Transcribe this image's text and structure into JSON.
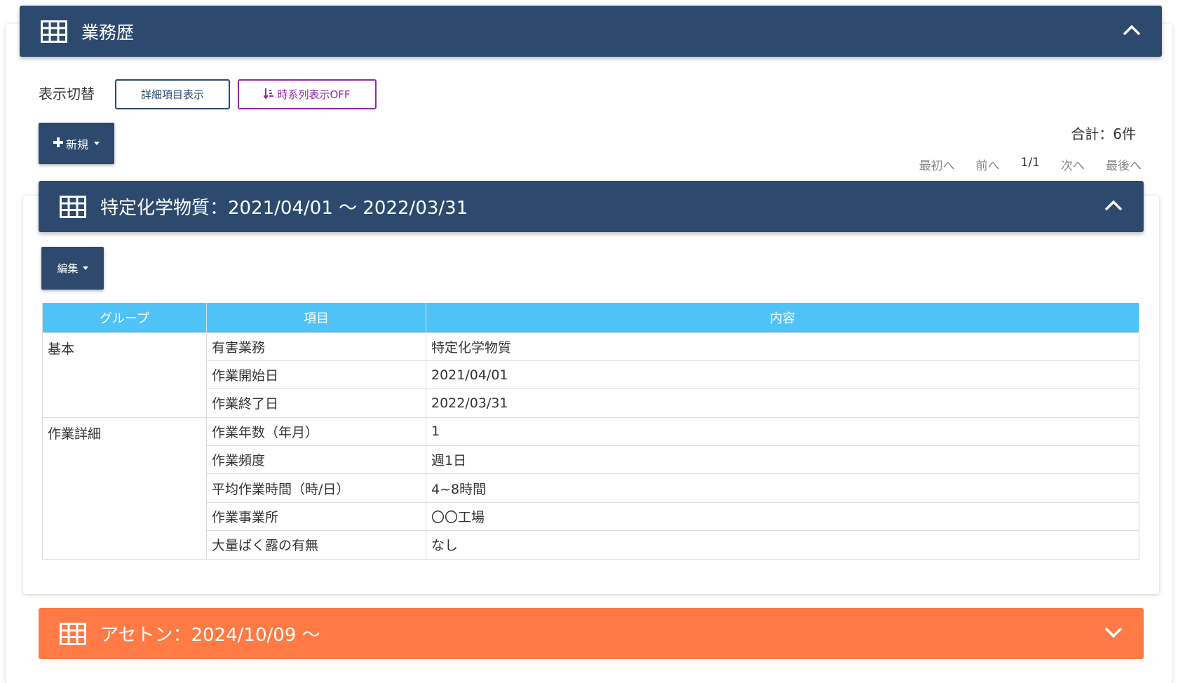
{
  "section": {
    "title": "業務歴"
  },
  "display_toggle": {
    "label": "表示切替",
    "detail_button": "詳細項目表示",
    "timeseries_button": "時系列表示OFF"
  },
  "actions": {
    "new_button": "新規"
  },
  "summary": {
    "total": "合計：6件"
  },
  "pagination": {
    "first": "最初へ",
    "prev": "前へ",
    "current": "1/1",
    "next": "次へ",
    "last": "最後へ"
  },
  "records": [
    {
      "title": "特定化学物質：2021/04/01 ～ 2022/03/31",
      "edit_button": "編集",
      "table": {
        "headers": [
          "グループ",
          "項目",
          "内容"
        ],
        "groups": [
          {
            "name": "基本",
            "rows": [
              {
                "item": "有害業務",
                "value": "特定化学物質"
              },
              {
                "item": "作業開始日",
                "value": "2021/04/01"
              },
              {
                "item": "作業終了日",
                "value": "2022/03/31"
              }
            ]
          },
          {
            "name": "作業詳細",
            "rows": [
              {
                "item": "作業年数（年月）",
                "value": "1"
              },
              {
                "item": "作業頻度",
                "value": "週1日"
              },
              {
                "item": "平均作業時間（時/日）",
                "value": "4~8時間"
              },
              {
                "item": "作業事業所",
                "value": "〇〇工場"
              },
              {
                "item": "大量ばく露の有無",
                "value": "なし"
              }
            ]
          }
        ]
      }
    },
    {
      "title": "アセトン：2024/10/09 ～"
    }
  ],
  "colors": {
    "header_navy": "#2d4a6e",
    "table_header": "#4fc3f7",
    "accent_orange": "#ff7a45",
    "timeseries_purple": "#8e2aa8"
  }
}
